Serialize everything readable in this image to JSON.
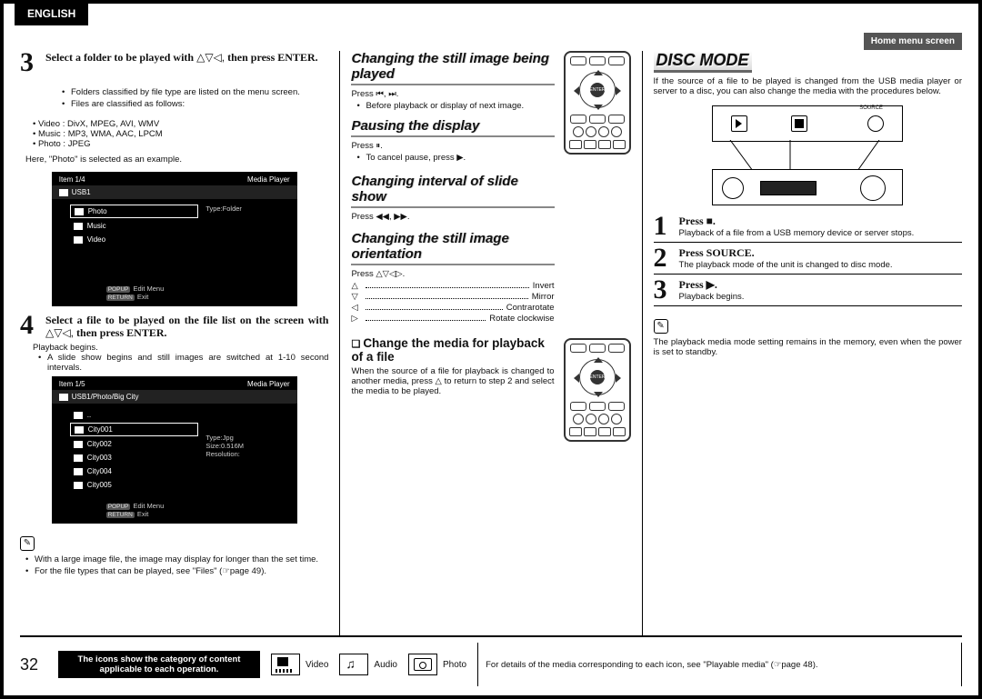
{
  "lang_tab": "ENGLISH",
  "page_label": "Home menu screen",
  "page_number": "32",
  "col1": {
    "step3": {
      "num": "3",
      "text_a": "Select a folder to be played with ",
      "nav": "△▽◁,",
      "text_b": " then press ",
      "enter": "ENTER",
      "post": "."
    },
    "bullets": [
      "Folders classified by file type are listed on the menu screen.",
      "Files are classified as follows:"
    ],
    "types": [
      "Video : DivX, MPEG, AVI, WMV",
      "Music : MP3, WMA, AAC, LPCM",
      "Photo : JPEG"
    ],
    "example": "Here, \"Photo\" is selected as an example.",
    "mp1": {
      "head_left": "Item 1/4",
      "head_right": "Media Player",
      "path": "USB1",
      "items": [
        "Photo",
        "Music",
        "Video"
      ],
      "sel_index": 0,
      "side": "Type:Folder",
      "foot1_btn": "POPUP",
      "foot1_lbl": "Edit Menu",
      "foot2_btn": "RETURN",
      "foot2_lbl": "Exit"
    },
    "step4": {
      "num": "4",
      "text_a": "Select a file to be played on the file list on the screen with ",
      "nav": "△▽◁,",
      "text_b": " then press ",
      "enter": "ENTER",
      "post": "."
    },
    "step4_body": [
      "Playback begins.",
      "A slide show begins and still images are switched at 1-10 second intervals."
    ],
    "mp2": {
      "head_left": "Item 1/5",
      "head_right": "Media Player",
      "path": "USB1/Photo/Big City",
      "updots": "..",
      "items": [
        "City001",
        "City002",
        "City003",
        "City004",
        "City005"
      ],
      "sel_index": 0,
      "side": [
        "Type:Jpg",
        "Size:0.516M",
        "Resolution:"
      ],
      "foot1_btn": "POPUP",
      "foot1_lbl": "Edit Menu",
      "foot2_btn": "RETURN",
      "foot2_lbl": "Exit"
    },
    "notes": [
      "With a large image file, the image may display for longer than the set time.",
      "For the file types that can be played, see \"Files\" (☞page 49)."
    ]
  },
  "col2": {
    "h1": "Changing the still image being played",
    "l1a": "Press ",
    "l1sym": "⏮, ⏭.",
    "l1b": "Before playback or display of next image.",
    "h2": "Pausing the display",
    "l2a": "Press ⏸.",
    "l2b": "To cancel pause, press ▶.",
    "h3": "Changing interval of slide show",
    "l3": "Press ◀◀, ▶▶.",
    "h4": "Changing the still image orientation",
    "l4": "Press △▽◁▷.",
    "rows": [
      {
        "sym": "△",
        "label": "Invert"
      },
      {
        "sym": "▽",
        "label": "Mirror"
      },
      {
        "sym": "◁",
        "label": "Contrarotate"
      },
      {
        "sym": "▷",
        "label": "Rotate clockwise"
      }
    ],
    "sub_head": "Change the media for playback of a file",
    "sub_body": "When the source of a file for playback is changed to another media, press △ to return to step 2 and select the media to be played."
  },
  "col3": {
    "title": "DISC MODE",
    "intro": "If the source of a file to be played is changed from the USB media player or server to a disc, you can also change the media with the procedures below.",
    "src_label": "SOURCE",
    "step1": {
      "num": "1",
      "label": "Press ",
      "sym": "■",
      "post": ".",
      "sub": "Playback of a file from a USB memory device or server stops."
    },
    "step2": {
      "num": "2",
      "label": "Press ",
      "word": "SOURCE",
      "post": ".",
      "sub": "The playback mode of the unit is changed to disc mode."
    },
    "step3": {
      "num": "3",
      "label": "Press ",
      "sym": "▶",
      "post": ".",
      "sub": "Playback begins."
    },
    "note": "The playback media mode setting remains in the memory, even when the power is set to standby."
  },
  "footer": {
    "black": "The icons show the category of content applicable to each operation.",
    "video": "Video",
    "audio": "Audio",
    "photo": "Photo",
    "note": "For details of the media corresponding to each icon, see \"Playable media\" (☞page 48)."
  }
}
